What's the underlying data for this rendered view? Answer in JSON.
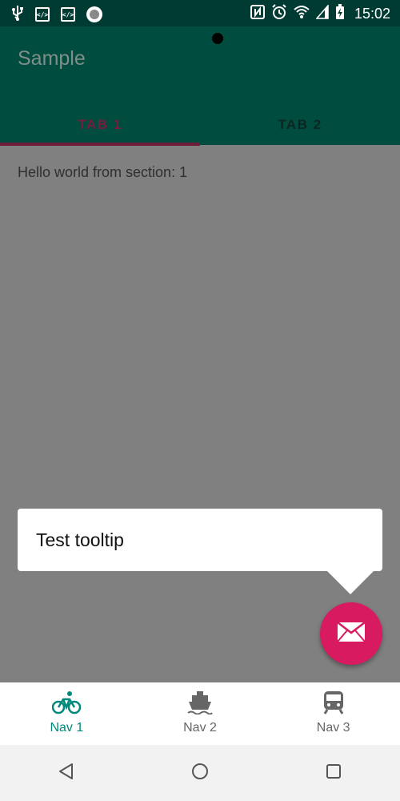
{
  "status_bar": {
    "time": "15:02",
    "icons": [
      "usb-icon",
      "code-icon",
      "code-icon",
      "sync-icon",
      "nfc-icon",
      "alarm-icon",
      "wifi-icon",
      "signal-icon",
      "battery-charging-icon"
    ]
  },
  "app_bar": {
    "title": "Sample",
    "tabs": [
      {
        "label": "TAB 1",
        "active": true
      },
      {
        "label": "TAB 2",
        "active": false
      }
    ]
  },
  "content": {
    "section_text": "Hello world from section: 1"
  },
  "tooltip": {
    "text": "Test tooltip"
  },
  "fab": {
    "icon": "mail-icon",
    "color": "#d81b60"
  },
  "bottom_nav": {
    "items": [
      {
        "label": "Nav 1",
        "icon": "bike-icon",
        "active": true
      },
      {
        "label": "Nav 2",
        "icon": "boat-icon",
        "active": false
      },
      {
        "label": "Nav 3",
        "icon": "train-icon",
        "active": false
      }
    ]
  },
  "colors": {
    "primary": "#004d40",
    "primary_dark": "#003b33",
    "accent": "#d81b60",
    "nav_active": "#00897b",
    "scrim": "#808080"
  }
}
